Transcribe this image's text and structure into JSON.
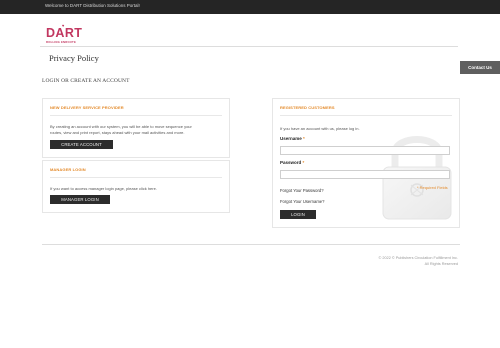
{
  "topbar": {
    "welcome": "Welcome to DART Distribution Solutions Portal!"
  },
  "logo": {
    "brand": "DART",
    "tagline": "ROLLING ENROUTE"
  },
  "page": {
    "title": "Privacy Policy",
    "login_heading": "LOGIN OR CREATE AN ACCOUNT"
  },
  "contact": {
    "label": "Contact Us"
  },
  "delivery_panel": {
    "title": "NEW DELIVERY SERVICE PROVIDER",
    "text_line1": "By creating an account with our system, you will be able to move sequence your",
    "text_line2": "routes, view and print report, stays ahead with your mail activities and more.",
    "button": "CREATE ACCOUNT"
  },
  "manager_panel": {
    "title": "MANAGER LOGIN",
    "text": "If you want to access manager login page, please click here.",
    "button": "MANAGER LOGIN"
  },
  "customer_panel": {
    "title": "REGISTERED CUSTOMERS",
    "intro": "If you have an account with us, please log in.",
    "username_label": "Username",
    "password_label": "Password",
    "required_mark": "*",
    "required_note": "* Required Fields",
    "forgot_password": "Forgot Your Password?",
    "forgot_username": "Forgot Your Username?",
    "login_button": "LOGIN"
  },
  "footer": {
    "copyright": "© 2022 © Publishers Circulation Fulfillment Inc.",
    "rights": "All Rights Reserved"
  },
  "colors": {
    "brand": "#c23760",
    "accent": "#e48a2a",
    "topbar": "#252525",
    "button": "#2c2c2c"
  }
}
